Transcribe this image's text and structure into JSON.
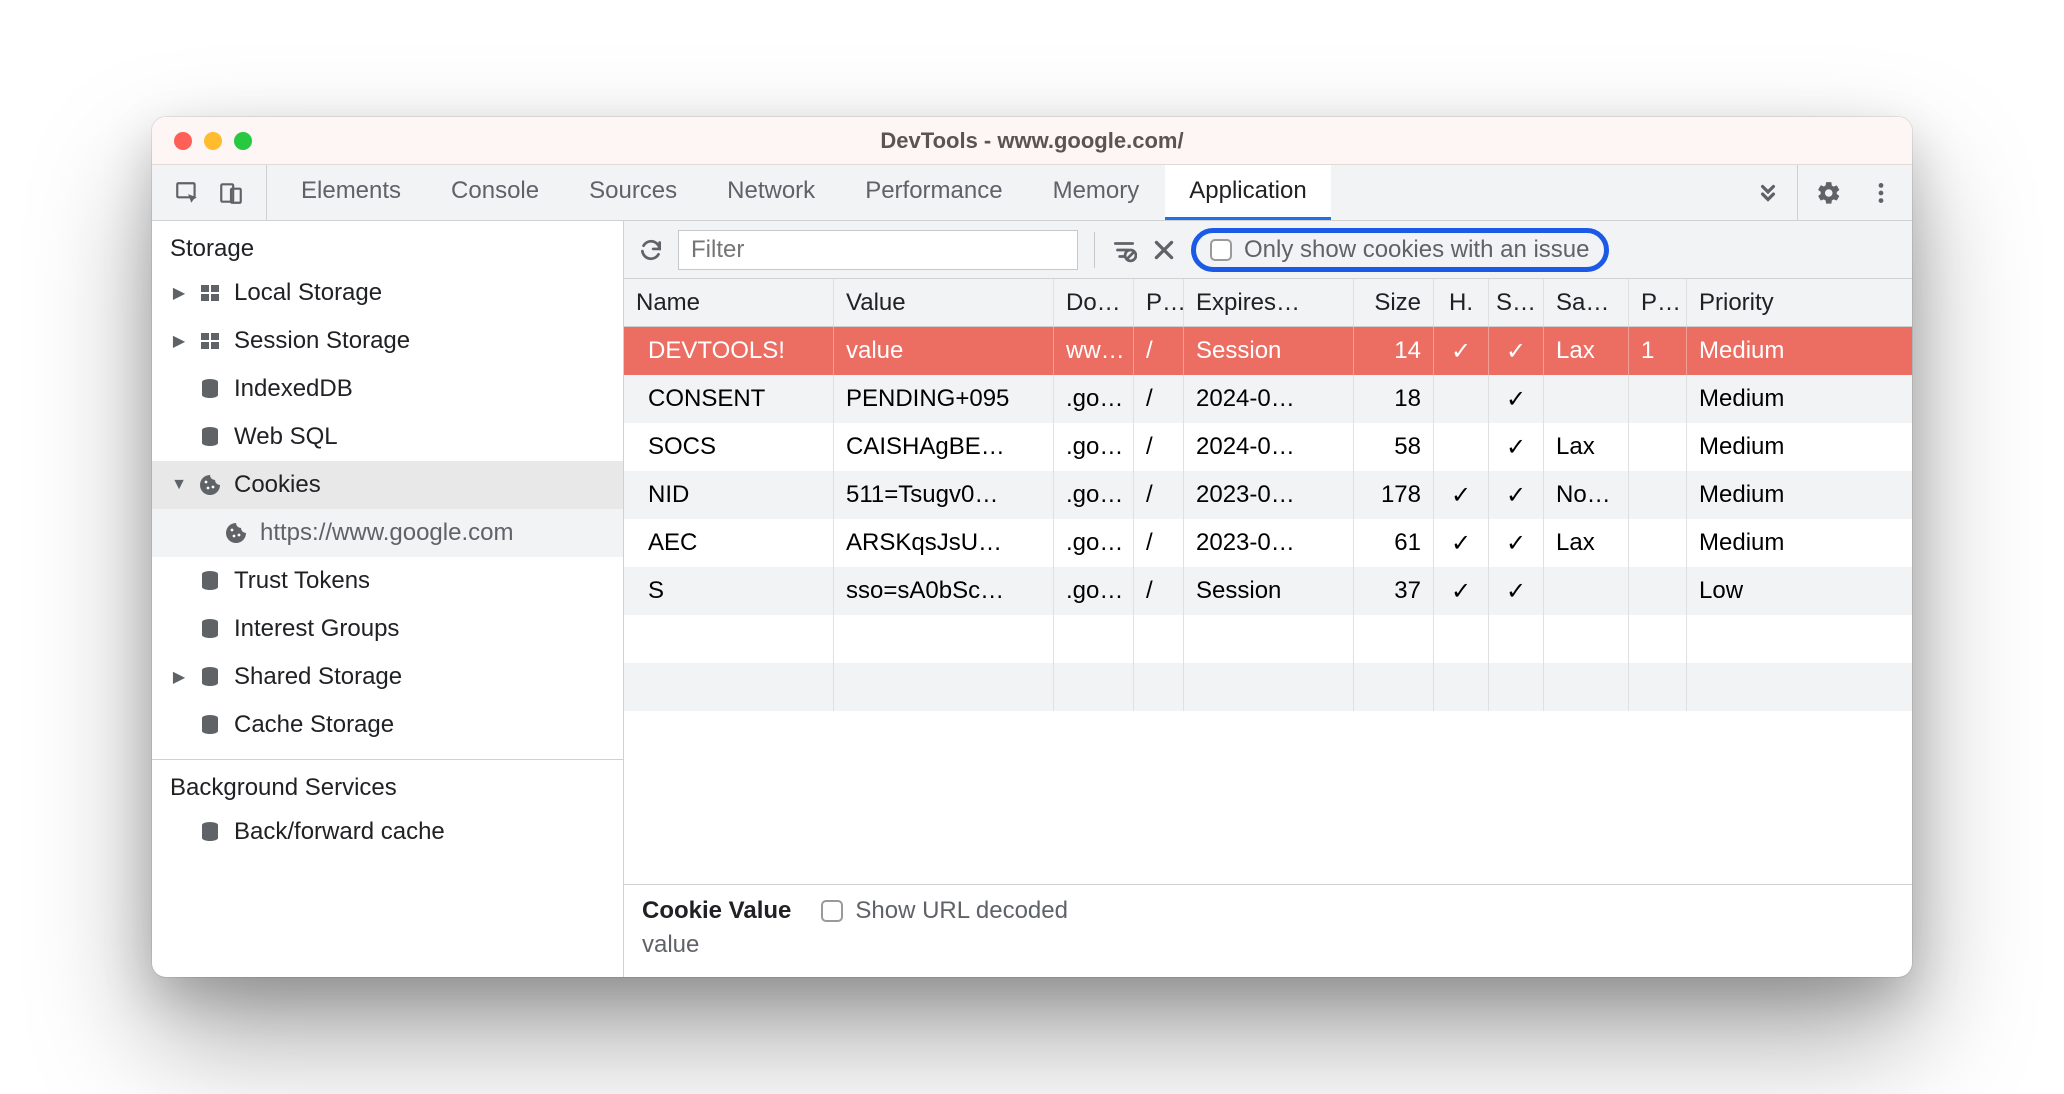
{
  "window": {
    "title": "DevTools - www.google.com/"
  },
  "tabs": {
    "items": [
      "Elements",
      "Console",
      "Sources",
      "Network",
      "Performance",
      "Memory",
      "Application"
    ],
    "active": "Application"
  },
  "sidebar": {
    "sections": {
      "storage": {
        "title": "Storage",
        "items": [
          {
            "label": "Local Storage",
            "icon": "grid",
            "expandable": true,
            "expanded": false
          },
          {
            "label": "Session Storage",
            "icon": "grid",
            "expandable": true,
            "expanded": false
          },
          {
            "label": "IndexedDB",
            "icon": "db",
            "expandable": false
          },
          {
            "label": "Web SQL",
            "icon": "db",
            "expandable": false
          },
          {
            "label": "Cookies",
            "icon": "cookie",
            "expandable": true,
            "expanded": true,
            "children": [
              {
                "label": "https://www.google.com",
                "icon": "cookie",
                "selected": true
              }
            ]
          },
          {
            "label": "Trust Tokens",
            "icon": "db",
            "expandable": false
          },
          {
            "label": "Interest Groups",
            "icon": "db",
            "expandable": false
          },
          {
            "label": "Shared Storage",
            "icon": "db",
            "expandable": true,
            "expanded": false
          },
          {
            "label": "Cache Storage",
            "icon": "db",
            "expandable": false
          }
        ]
      },
      "background": {
        "title": "Background Services",
        "items": [
          {
            "label": "Back/forward cache",
            "icon": "db"
          }
        ]
      }
    }
  },
  "filterbar": {
    "placeholder": "Filter",
    "only_issues_label": "Only show cookies with an issue",
    "only_issues_checked": false
  },
  "table": {
    "columns": [
      "Name",
      "Value",
      "Do…",
      "P…",
      "Expires…",
      "Size",
      "H.",
      "S…",
      "Sa…",
      "P…",
      "Priority"
    ],
    "rows": [
      {
        "name": "DEVTOOLS!",
        "value": "value",
        "domain": "ww…",
        "path": "/",
        "expires": "Session",
        "size": "14",
        "http": "✓",
        "secure": "✓",
        "samesite": "Lax",
        "partition": "1",
        "priority": "Medium",
        "selected": true
      },
      {
        "name": "CONSENT",
        "value": "PENDING+095",
        "domain": ".go…",
        "path": "/",
        "expires": "2024-0…",
        "size": "18",
        "http": "",
        "secure": "✓",
        "samesite": "",
        "partition": "",
        "priority": "Medium"
      },
      {
        "name": "SOCS",
        "value": "CAISHAgBE…",
        "domain": ".go…",
        "path": "/",
        "expires": "2024-0…",
        "size": "58",
        "http": "",
        "secure": "✓",
        "samesite": "Lax",
        "partition": "",
        "priority": "Medium"
      },
      {
        "name": "NID",
        "value": "511=Tsugv0…",
        "domain": ".go…",
        "path": "/",
        "expires": "2023-0…",
        "size": "178",
        "http": "✓",
        "secure": "✓",
        "samesite": "No…",
        "partition": "",
        "priority": "Medium"
      },
      {
        "name": "AEC",
        "value": "ARSKqsJsU…",
        "domain": ".go…",
        "path": "/",
        "expires": "2023-0…",
        "size": "61",
        "http": "✓",
        "secure": "✓",
        "samesite": "Lax",
        "partition": "",
        "priority": "Medium"
      },
      {
        "name": "S",
        "value": "sso=sA0bSc…",
        "domain": ".go…",
        "path": "/",
        "expires": "Session",
        "size": "37",
        "http": "✓",
        "secure": "✓",
        "samesite": "",
        "partition": "",
        "priority": "Low"
      }
    ]
  },
  "detail": {
    "label": "Cookie Value",
    "show_decoded_label": "Show URL decoded",
    "show_decoded_checked": false,
    "value": "value"
  }
}
